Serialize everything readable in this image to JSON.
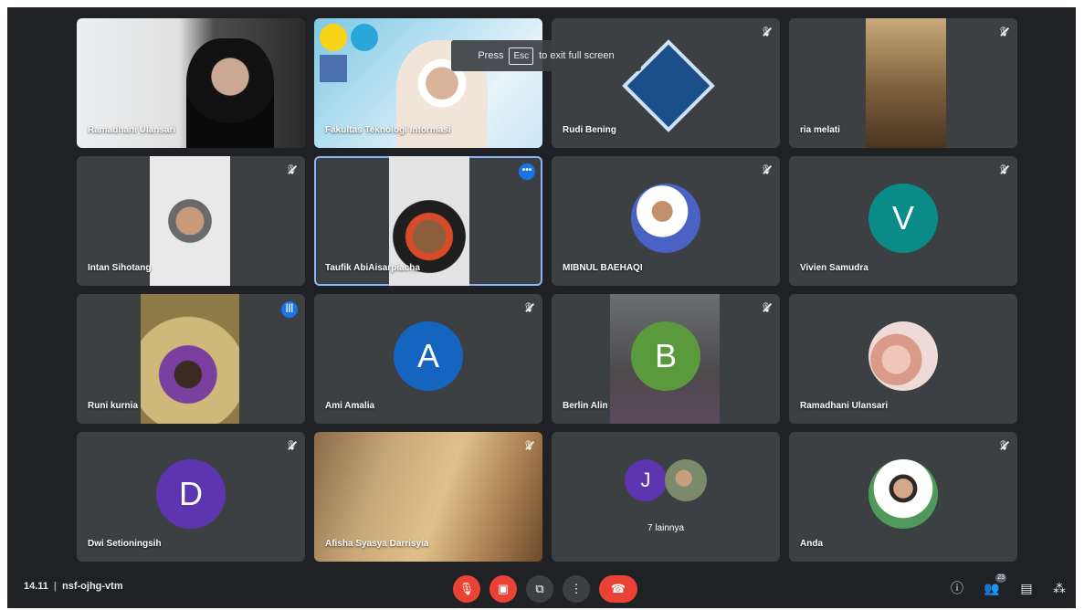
{
  "toast": {
    "press": "Press",
    "key": "Esc",
    "rest": "to exit full screen"
  },
  "tiles": [
    {
      "name": "Ramadhani Ulansari"
    },
    {
      "name": "Fakultas Teknologi Informasi"
    },
    {
      "name": "Rudi Bening"
    },
    {
      "name": "ria melati"
    },
    {
      "name": "Intan Sihotang"
    },
    {
      "name": "Taufik AbiAisarpiacha"
    },
    {
      "name": "MIBNUL BAEHAQI"
    },
    {
      "name": "Vivien Samudra",
      "initial": "V",
      "color": "#0b8a8a"
    },
    {
      "name": "Runi kurnia"
    },
    {
      "name": "Ami Amalia",
      "initial": "A",
      "color": "#1565c0"
    },
    {
      "name": "Berlin Alin",
      "initial": "B",
      "color": "#5b9a3c"
    },
    {
      "name": "Ramadhani Ulansari"
    },
    {
      "name": "Dwi Setioningsih",
      "initial": "D",
      "color": "#5e35b1"
    },
    {
      "name": "Afisha Syasya Darrisyia"
    },
    {
      "name": "7 lainnya",
      "initial": "J",
      "color": "#5e35b1"
    },
    {
      "name": "Anda"
    }
  ],
  "bottombar": {
    "time": "14.11",
    "code": "nsf-ojhg-vtm",
    "people_count": "23"
  },
  "colors": {
    "background": "#202124",
    "tile": "#3c4043",
    "red": "#ea4335",
    "highlight": "#8ab4f8"
  }
}
